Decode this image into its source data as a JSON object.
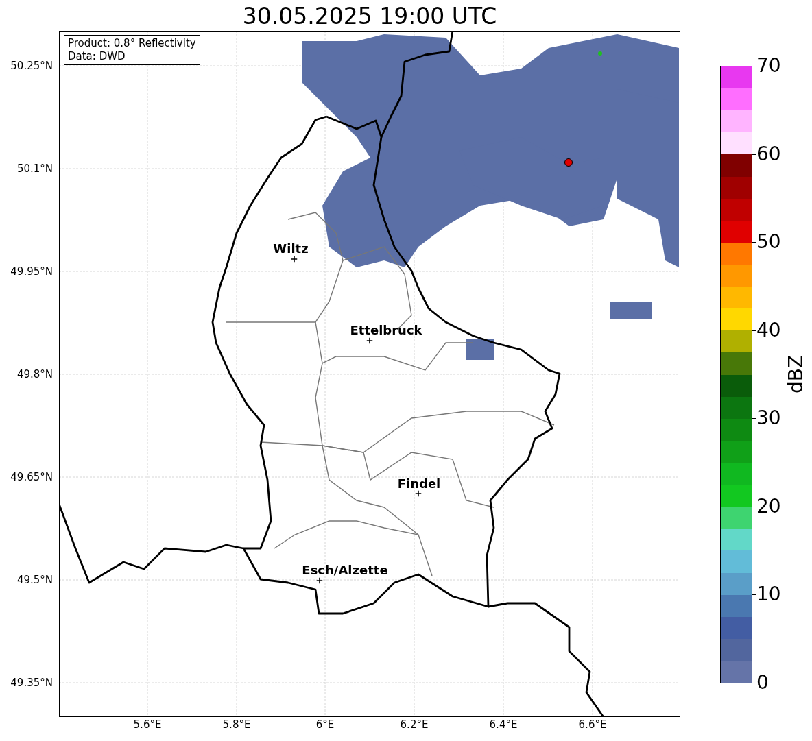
{
  "title": "30.05.2025 19:00 UTC",
  "map": {
    "info_box": [
      "Product: 0.8° Reflectivity",
      "Data: DWD"
    ],
    "yticks": [
      "50.25°N",
      "50.1°N",
      "49.95°N",
      "49.8°N",
      "49.65°N",
      "49.5°N",
      "49.35°N"
    ],
    "xticks": [
      "5.6°E",
      "5.8°E",
      "6°E",
      "6.2°E",
      "6.4°E",
      "6.6°E"
    ],
    "cities": [
      {
        "name": "Wiltz"
      },
      {
        "name": "Ettelbruck"
      },
      {
        "name": "Findel"
      },
      {
        "name": "Esch/Alzette"
      }
    ]
  },
  "colorbar": {
    "label": "dBZ",
    "ticks": [
      "70",
      "60",
      "50",
      "40",
      "30",
      "20",
      "10",
      "0"
    ],
    "bins": [
      {
        "color": "#e838f0"
      },
      {
        "color": "#ff6eff"
      },
      {
        "color": "#ffb4ff"
      },
      {
        "color": "#ffe0ff"
      },
      {
        "color": "#800000"
      },
      {
        "color": "#a00000"
      },
      {
        "color": "#c00000"
      },
      {
        "color": "#e00000"
      },
      {
        "color": "#ff7800"
      },
      {
        "color": "#ff9800"
      },
      {
        "color": "#ffb800"
      },
      {
        "color": "#ffd800"
      },
      {
        "color": "#b0b000"
      },
      {
        "color": "#487808"
      },
      {
        "color": "#0a5c0a"
      },
      {
        "color": "#0c7610"
      },
      {
        "color": "#0e8a12"
      },
      {
        "color": "#10a018"
      },
      {
        "color": "#10b820"
      },
      {
        "color": "#12c820"
      },
      {
        "color": "#3ed470"
      },
      {
        "color": "#62d8c8"
      },
      {
        "color": "#62bcd8"
      },
      {
        "color": "#5a9ec8"
      },
      {
        "color": "#4a78b0"
      },
      {
        "color": "#435da3"
      },
      {
        "color": "#52669e"
      },
      {
        "color": "#6574a8"
      }
    ]
  }
}
